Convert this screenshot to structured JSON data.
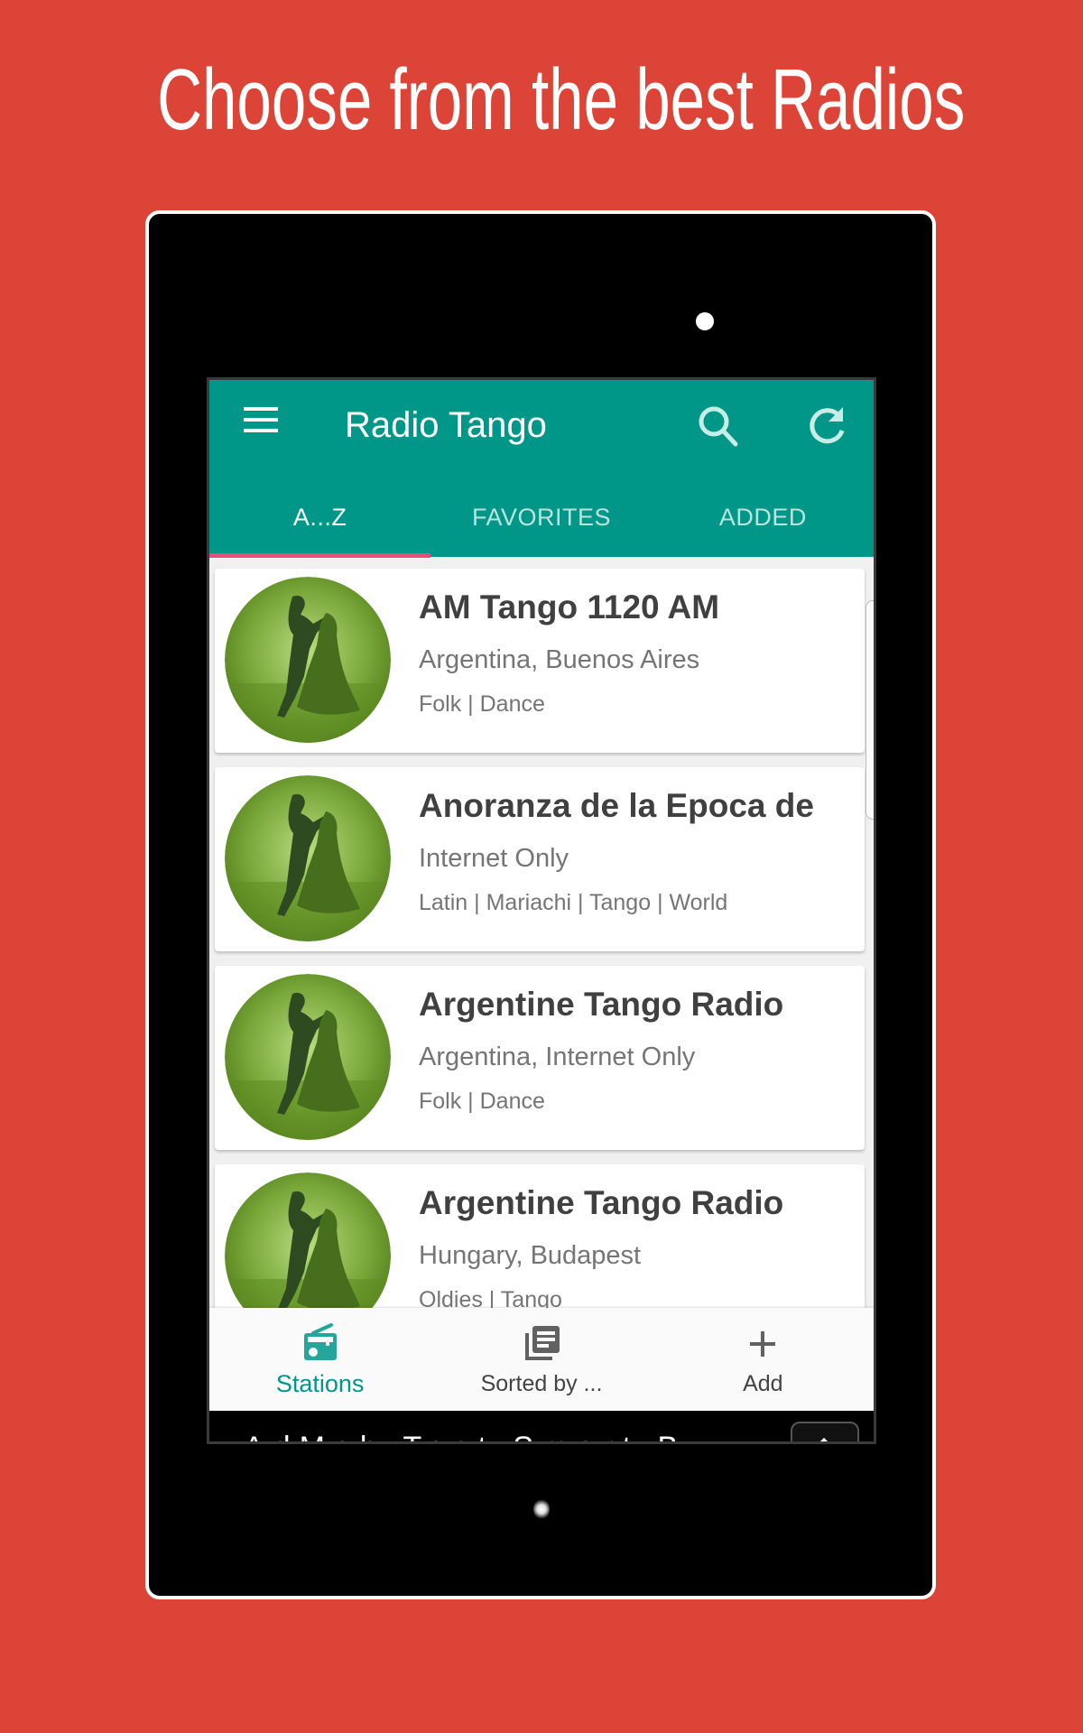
{
  "promo": {
    "headline": "Choose from the best Radios"
  },
  "colors": {
    "background": "#db4437",
    "appbar": "#009688",
    "tab_indicator": "#e94c7e",
    "active_nav": "#00968a"
  },
  "app": {
    "title": "Radio Tango",
    "icons": {
      "menu": "hamburger-menu-icon",
      "search": "search-icon",
      "refresh": "refresh-icon"
    },
    "tabs": [
      {
        "label": "A...Z",
        "active": true
      },
      {
        "label": "FAVORITES",
        "active": false
      },
      {
        "label": "ADDED",
        "active": false
      }
    ],
    "stations": [
      {
        "name": "AM Tango 1120 AM",
        "location": "Argentina, Buenos Aires",
        "genres": "Folk | Dance"
      },
      {
        "name": "Anoranza de la Epoca de",
        "location": "Internet Only",
        "genres": "Latin | Mariachi | Tango | World"
      },
      {
        "name": "Argentine Tango Radio",
        "location": "Argentina, Internet Only",
        "genres": "Folk | Dance"
      },
      {
        "name": "Argentine Tango Radio",
        "location": "Hungary, Budapest",
        "genres": "Oldies | Tango"
      }
    ],
    "bottom_nav": [
      {
        "label": "Stations",
        "icon": "radio-icon",
        "active": true
      },
      {
        "label": "Sorted by ...",
        "icon": "library-books-icon",
        "active": false
      },
      {
        "label": "Add",
        "icon": "plus-icon",
        "active": false
      }
    ],
    "ad": {
      "text": "AdMob Test Smart B"
    }
  }
}
